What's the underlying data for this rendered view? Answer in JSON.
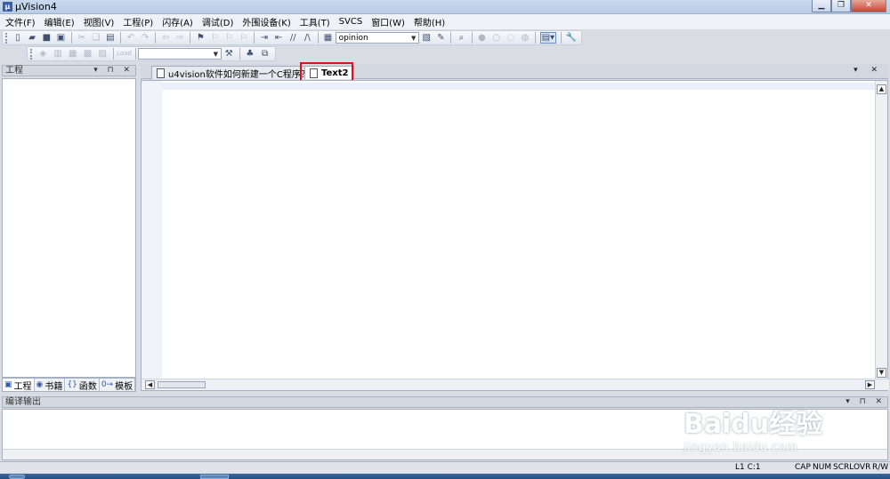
{
  "window": {
    "title": "µVision4",
    "icon_letter": "µ"
  },
  "menu": [
    "文件(F)",
    "编辑(E)",
    "视图(V)",
    "工程(P)",
    "闪存(A)",
    "调试(D)",
    "外围设备(K)",
    "工具(T)",
    "SVCS",
    "窗口(W)",
    "帮助(H)"
  ],
  "toolbar": {
    "search_combo_value": "opinion",
    "load_label": "Load"
  },
  "project_panel": {
    "title": "工程",
    "controls": "▾ ⊓ ✕",
    "tabs": [
      {
        "label": "工程",
        "icon": "project-icon"
      },
      {
        "label": "书籍",
        "icon": "books-icon"
      },
      {
        "label": "函数",
        "icon": "functions-icon"
      },
      {
        "label": "模板",
        "icon": "templates-icon"
      }
    ]
  },
  "editor": {
    "tabs": [
      {
        "label": "u4vision软件如何新建一个C程序？",
        "active": false
      },
      {
        "label": "Text2",
        "active": true
      }
    ],
    "controls": "▾ ✕"
  },
  "output_panel": {
    "title": "编译输出",
    "controls": "▾ ⊓ ✕"
  },
  "status": {
    "position": "L1 C:1",
    "indicators": [
      "CAP",
      "NUM",
      "SCRL",
      "OVR",
      "R/W"
    ]
  },
  "watermark": {
    "main": "Baidu经验",
    "sub": "jingyan.baidu.com"
  },
  "colors": {
    "highlight": "#e0101a",
    "title_bar": "#c9d9ee"
  }
}
